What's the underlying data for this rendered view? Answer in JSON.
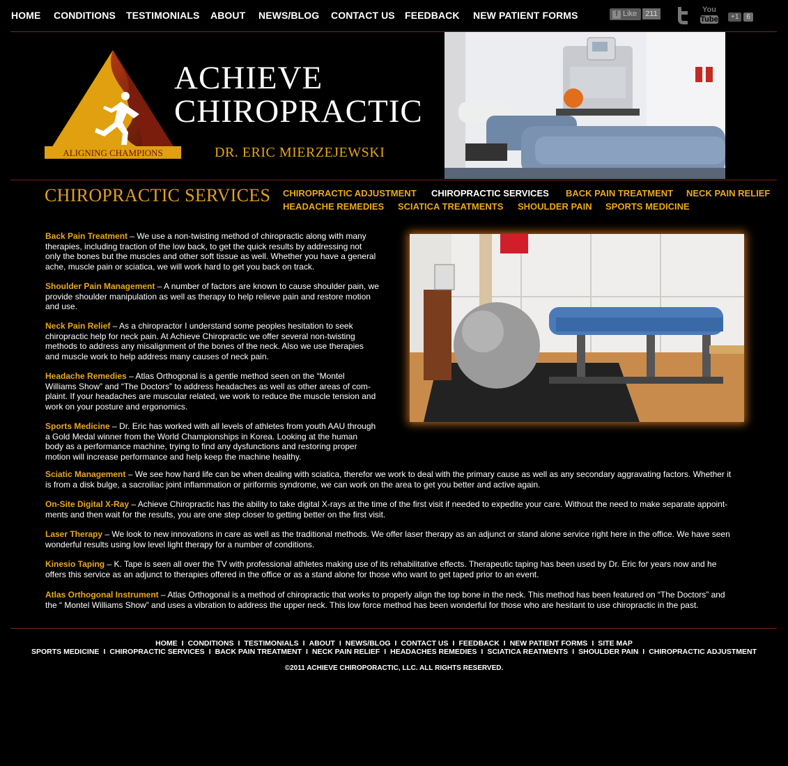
{
  "top_nav": [
    {
      "id": "home",
      "label": "HOME"
    },
    {
      "id": "conditions",
      "label": "CONDITIONS"
    },
    {
      "id": "testimonials",
      "label": "TESTIMONIALS"
    },
    {
      "id": "about",
      "label": "ABOUT"
    },
    {
      "id": "news",
      "label": "NEWS/BLOG"
    },
    {
      "id": "contact",
      "label": "CONTACT US"
    },
    {
      "id": "feedback",
      "label": "FEEDBACK"
    },
    {
      "id": "forms",
      "label": "NEW PATIENT FORMS"
    }
  ],
  "social": {
    "facebook_label": "Like",
    "facebook_count": "211",
    "youtube_label_1": "You",
    "youtube_label_2": "Tube",
    "gplus_label": "+1",
    "gplus_count": "6"
  },
  "header": {
    "logo_tagline": "ALIGNING CHAMPIONS",
    "brand_line1": "ACHIEVE",
    "brand_line2": "CHIROPRACTIC",
    "doctor": "DR. ERIC MIERZEJEWSKI"
  },
  "section_title": "CHIROPRACTIC SERVICES",
  "sub_nav": [
    {
      "label": "CHIROPRACTIC ADJUSTMENT",
      "active": false
    },
    {
      "label": "CHIROPRACTIC SERVICES",
      "active": true
    },
    {
      "label": "BACK PAIN TREATMENT",
      "active": false
    },
    {
      "label": "NECK PAIN RELIEF",
      "active": false
    },
    {
      "label": "HEADACHE REMEDIES",
      "active": false
    },
    {
      "label": "SCIATICA TREATMENTS",
      "active": false
    },
    {
      "label": "SHOULDER PAIN",
      "active": false
    },
    {
      "label": "SPORTS MEDICINE",
      "active": false
    }
  ],
  "services": [
    {
      "title": "Back Pain Treatment",
      "lines": [
        "Back Pain Treatment – We use a non-twisting method of chiropractic along with many",
        "therapies, including traction of the low back, to get the quick results by addressing not",
        "only the bones but the muscles and other soft tissue as well. Whether you have a general",
        "ache, muscle pain or sciatica, we will work hard to get you back on track."
      ]
    },
    {
      "title": "Shoulder Pain Management",
      "lines": [
        "Shoulder Pain Management – A number of factors are known to cause shoulder pain, we",
        "provide shoulder manipulation as well as therapy to help relieve pain and restore motion",
        "and use."
      ]
    },
    {
      "title": "Neck Pain Relief",
      "lines": [
        "Neck Pain Relief – As a chiropractor I understand some peoples hesitation to seek",
        "chiropractic help for neck pain. At Achieve Chiropractic we offer several non-twisting",
        "methods to address any misalignment of the bones of the neck. Also we use therapies",
        "and muscle work to help address many causes of neck pain."
      ]
    },
    {
      "title": "Headache Remedies",
      "lines": [
        "Headache Remedies – Atlas Orthogonal is a gentle method seen on the “Montel",
        "Williams Show” and “The Doctors” to address headaches as well as other areas of com-",
        "plaint. If your headaches are muscular related, we work to reduce the muscle tension and",
        "work on your posture and ergonomics."
      ]
    },
    {
      "title": "Sports Medicine",
      "lines": [
        "Sports Medicine – Dr. Eric has worked with all levels of athletes from youth AAU through",
        "a Gold Medal winner from the World Championships in Korea. Looking at the human",
        "body as a performance machine, trying to find any dysfunctions and restoring proper",
        "motion will increase performance and help keep the machine healthy."
      ]
    },
    {
      "title": "Sciatic Management",
      "lines": [
        "Sciatic Management – We see how hard life can be when dealing with sciatica, therefor we work to deal with the primary cause as well as any secondary aggravating factors. Whether it",
        "is from a disk bulge, a sacroiliac joint inflammation or piriformis syndrome, we can work on the area to get you better and active again."
      ]
    },
    {
      "title": "On-Site Digital X-Ray",
      "lines": [
        "On-Site Digital X-Ray – Achieve Chiropractic has the ability to take digital X-rays at the time of the first visit if needed to expedite your care. Without the need to make separate appoint-",
        "ments and then wait for  the results, you are one step closer to getting better on the first visit."
      ]
    },
    {
      "title": "Laser Therapy",
      "lines": [
        "Laser Therapy – We look to new innovations in care as well as the traditional methods. We offer laser therapy as an adjunct or stand alone service right here in the office. We have seen",
        "wonderful results using low level light therapy for a number of conditions."
      ]
    },
    {
      "title": "Kinesio Taping",
      "lines": [
        "Kinesio Taping – K. Tape is seen all over the TV with professional athletes making use of its rehabilitative effects. Therapeutic taping has been used by Dr. Eric for years now and he",
        "offers this service as an adjunct to therapies offered in the office or as a stand alone for those who want to get taped prior to an event."
      ]
    },
    {
      "title": "Atlas Orthogonal Instrument",
      "lines": [
        "Atlas Orthogonal Instrument – Atlas Orthogonal is a method of chiropractic that works to properly align the top bone in the neck. This method has been featured on “The Doctors” and",
        "the “ Montel Williams Show” and  uses a vibration to address the upper neck. This low force method has been wonderful for those who are hesitant to use chiropractic in the past."
      ]
    }
  ],
  "footer": {
    "links_row1": [
      "HOME",
      "CONDITIONS",
      "TESTIMONIALS",
      "ABOUT",
      "NEWS/BLOG",
      "CONTACT US",
      "FEEDBACK",
      "NEW PATIENT FORMS",
      "SITE MAP"
    ],
    "links_row2": [
      "SPORTS MEDICINE",
      "CHIROPRACTIC SERVICES",
      "BACK PAIN TREATMENT",
      "NECK PAIN RELIEF",
      "HEADACHES REMEDIES",
      "SCIATICA REATMENTS",
      "SHOULDER PAIN",
      "CHIROPRACTIC ADJUSTMENT"
    ],
    "separator": "I",
    "copyright": "©2011 ACHIEVE CHIROPORACTIC, LLC. ALL RIGHTS RESERVED."
  },
  "colors": {
    "accent": "#e9a81d",
    "rule": "#7a2418",
    "background": "#000000"
  }
}
